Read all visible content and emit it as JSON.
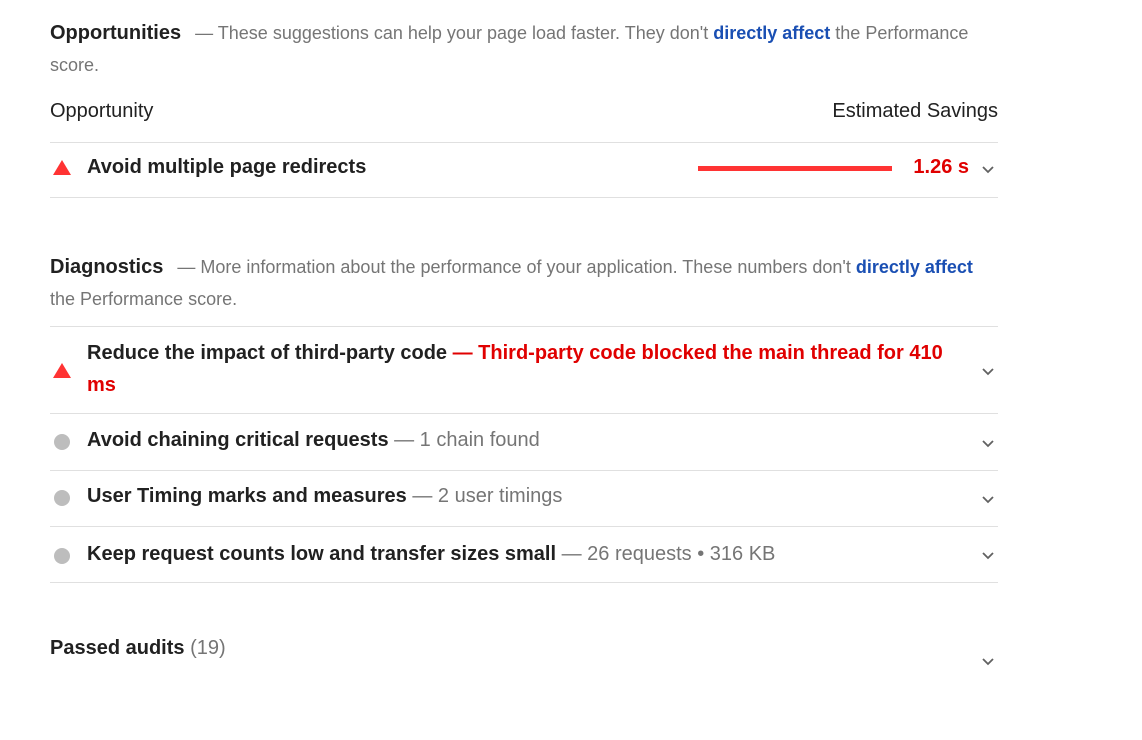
{
  "opportunities": {
    "title": "Opportunities",
    "desc_prefix": "— These suggestions can help your page load faster. They don't",
    "desc_link": "directly affect",
    "desc_suffix": "the Performance score.",
    "col_left": "Opportunity",
    "col_right": "Estimated Savings",
    "items": [
      {
        "title": "Avoid multiple page redirects",
        "savings": "1.26 s",
        "bar_fraction": 1.0,
        "status": "fail"
      }
    ]
  },
  "diagnostics": {
    "title": "Diagnostics",
    "desc_prefix": "— More information about the performance of your application. These numbers don't",
    "desc_link": "directly affect",
    "desc_suffix": "the Performance score.",
    "items": [
      {
        "title": "Reduce the impact of third-party code",
        "detail": "— Third-party code blocked the main thread for 410 ms",
        "status": "fail"
      },
      {
        "title": "Avoid chaining critical requests",
        "detail": "— 1 chain found",
        "status": "info"
      },
      {
        "title": "User Timing marks and measures",
        "detail": "— 2 user timings",
        "status": "info"
      },
      {
        "title": "Keep request counts low and transfer sizes small",
        "detail": "— 26 requests • 316 KB",
        "status": "info"
      }
    ]
  },
  "passed": {
    "label": "Passed audits",
    "count": "(19)"
  },
  "colors": {
    "fail": "#ff3333",
    "fail_text": "#e00000",
    "link": "#1a4fb3",
    "info": "#bdbdbd",
    "muted": "#757575"
  }
}
